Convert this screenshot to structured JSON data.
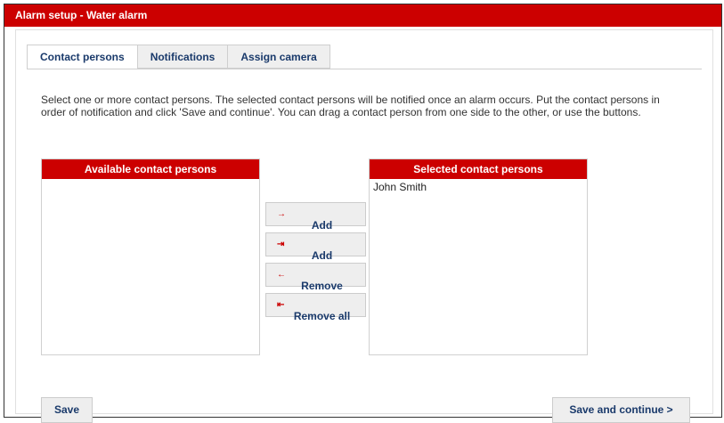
{
  "window": {
    "title": "Alarm setup - Water alarm"
  },
  "tabs": [
    {
      "label": "Contact persons",
      "active": true
    },
    {
      "label": "Notifications",
      "active": false
    },
    {
      "label": "Assign camera",
      "active": false
    }
  ],
  "intro_text": "Select one or more contact persons. The selected contact persons will be notified once an alarm occurs. Put the contact persons in order of notification and click 'Save and continue'. You can drag a contact person from one side to the other, or use the buttons.",
  "available": {
    "header": "Available contact persons",
    "items": []
  },
  "selected": {
    "header": "Selected contact persons",
    "items": [
      "John Smith"
    ]
  },
  "buttons": {
    "add_one": {
      "label": "Add",
      "icon": "arrow-right-icon"
    },
    "add_all": {
      "label": "Add",
      "icon": "arrow-right-bar-icon"
    },
    "remove_one": {
      "label": "Remove",
      "icon": "arrow-left-icon"
    },
    "remove_all": {
      "label": "Remove all",
      "icon": "arrow-left-bar-icon"
    }
  },
  "footer": {
    "save": "Save",
    "save_continue": "Save and continue >"
  },
  "colors": {
    "accent": "#cc0000",
    "link": "#1a3a6b"
  }
}
